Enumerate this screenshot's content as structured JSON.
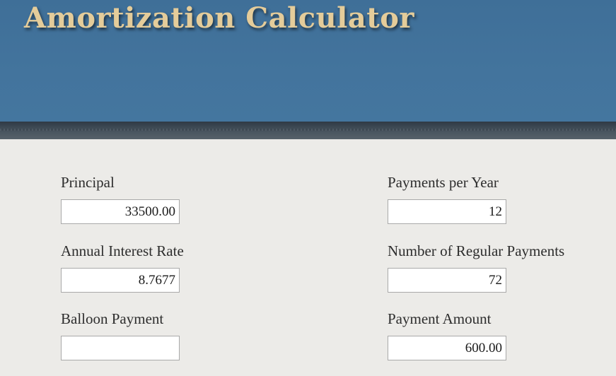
{
  "header": {
    "title": "Amortization Calculator"
  },
  "form": {
    "principal": {
      "label": "Principal",
      "value": "33500.00"
    },
    "annual_interest_rate": {
      "label": "Annual Interest Rate",
      "value": "8.7677"
    },
    "balloon_payment": {
      "label": "Balloon Payment",
      "value": ""
    },
    "payments_per_year": {
      "label": "Payments per Year",
      "value": "12"
    },
    "number_of_regular_payments": {
      "label": "Number of Regular Payments",
      "value": "72"
    },
    "payment_amount": {
      "label": "Payment Amount",
      "value": "600.00"
    }
  },
  "colors": {
    "header_bg": "#44769f",
    "title_text": "#e4cc9a",
    "page_bg": "#ecebe8"
  }
}
